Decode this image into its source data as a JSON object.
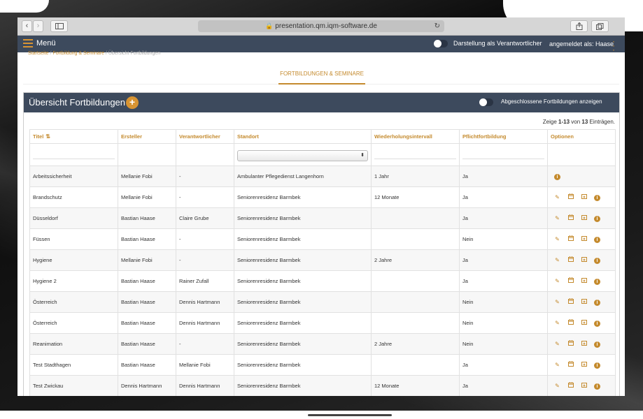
{
  "browser": {
    "url": "presentation.qm.iqm-software.de",
    "back": "‹",
    "forward": "›"
  },
  "nav": {
    "menu_label": "Menü",
    "toggle_label": "Darstellung als Verantwortlicher",
    "user_label": "angemeldet als: Haase"
  },
  "breadcrumb": {
    "home": "Startseite",
    "section": "Fortbildung & Seminare",
    "current": "Übersicht Fortbildungen"
  },
  "tab": {
    "label": "FORTBILDUNGEN & SEMINARE"
  },
  "panel": {
    "title": "Übersicht Fortbildungen",
    "add_label": "+",
    "toggle_label": "Abgeschlossene Fortbildungen anzeigen",
    "count_prefix": "Zeige ",
    "count_range": "1-13",
    "count_mid": " von ",
    "count_total": "13",
    "count_suffix": " Einträgen."
  },
  "table": {
    "headers": {
      "title": "Titel",
      "creator": "Ersteller",
      "responsible": "Verantwortlicher",
      "location": "Standort",
      "interval": "Wiederholungsintervall",
      "mandatory": "Pflichtfortbildung",
      "options": "Optionen"
    },
    "rows": [
      {
        "title": "Arbeitssicherheit",
        "creator": "Mellanie Fobi",
        "responsible": "-",
        "location": "Ambulanter Pflegedienst Langenhorn",
        "interval": "1 Jahr",
        "mandatory": "Ja"
      },
      {
        "title": "Brandschutz",
        "creator": "Mellanie Fobi",
        "responsible": "-",
        "location": "Seniorenresidenz Barmbek",
        "interval": "12 Monate",
        "mandatory": "Ja"
      },
      {
        "title": "Düsseldorf",
        "creator": "Bastian Haase",
        "responsible": "Claire Grube",
        "location": "Seniorenresidenz Barmbek",
        "interval": "",
        "mandatory": "Ja"
      },
      {
        "title": "Füssen",
        "creator": "Bastian Haase",
        "responsible": "-",
        "location": "Seniorenresidenz Barmbek",
        "interval": "",
        "mandatory": "Nein"
      },
      {
        "title": "Hygiene",
        "creator": "Mellanie Fobi",
        "responsible": "-",
        "location": "Seniorenresidenz Barmbek",
        "interval": "2 Jahre",
        "mandatory": "Ja"
      },
      {
        "title": "Hygiene 2",
        "creator": "Bastian Haase",
        "responsible": "Rainer Zufall",
        "location": "Seniorenresidenz Barmbek",
        "interval": "",
        "mandatory": "Ja"
      },
      {
        "title": "Österreich",
        "creator": "Bastian Haase",
        "responsible": "Dennis Hartmann",
        "location": "Seniorenresidenz Barmbek",
        "interval": "",
        "mandatory": "Nein"
      },
      {
        "title": "Österreich",
        "creator": "Bastian Haase",
        "responsible": "Dennis Hartmann",
        "location": "Seniorenresidenz Barmbek",
        "interval": "",
        "mandatory": "Nein"
      },
      {
        "title": "Reanimation",
        "creator": "Bastian Haase",
        "responsible": "-",
        "location": "Seniorenresidenz Barmbek",
        "interval": "2 Jahre",
        "mandatory": "Nein"
      },
      {
        "title": "Test Stadthagen",
        "creator": "Bastian Haase",
        "responsible": "Mellanie Fobi",
        "location": "Seniorenresidenz Barmbek",
        "interval": "",
        "mandatory": "Ja"
      },
      {
        "title": "Test Zwickau",
        "creator": "Dennis Hartmann",
        "responsible": "Dennis Hartmann",
        "location": "Seniorenresidenz Barmbek",
        "interval": "12 Monate",
        "mandatory": "Ja"
      }
    ]
  },
  "colors": {
    "accent": "#c48a2d",
    "navbar": "#3d4a5d"
  }
}
